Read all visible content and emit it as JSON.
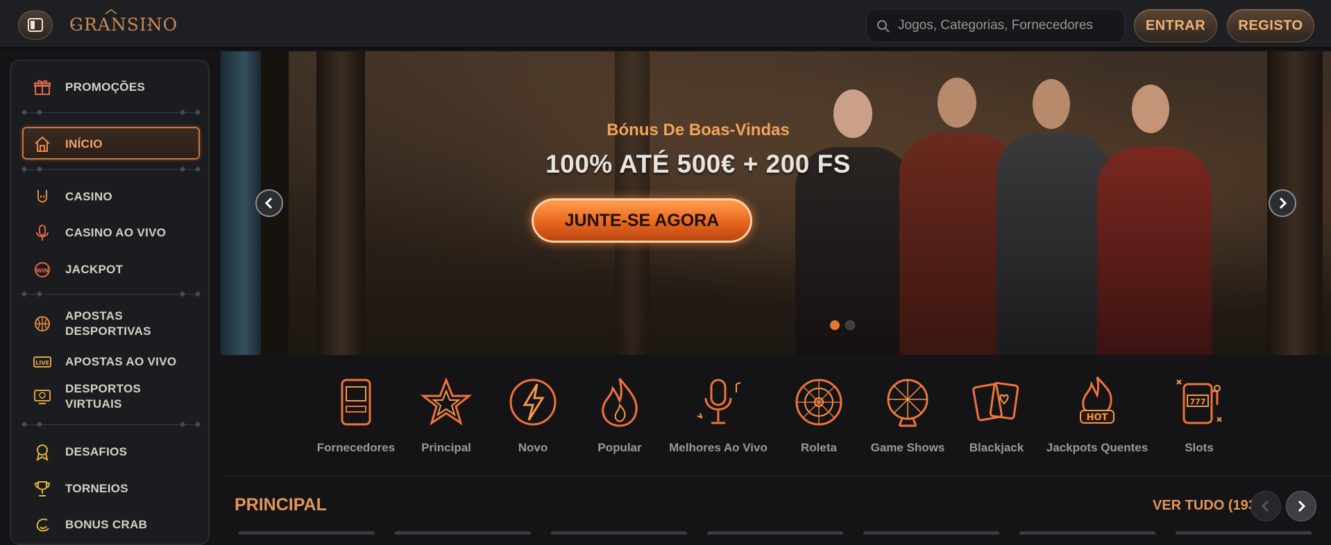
{
  "header": {
    "logo_text": "GRANSINO",
    "search_placeholder": "Jogos, Categorias, Fornecedores",
    "login_label": "ENTRAR",
    "register_label": "REGISTO"
  },
  "sidebar": {
    "items": [
      {
        "label": "PROMOÇÕES",
        "icon": "gift-icon"
      },
      {
        "label": "INÍCIO",
        "icon": "home-icon",
        "active": true
      },
      {
        "label": "CASINO",
        "icon": "rock-hand-icon"
      },
      {
        "label": "CASINO AO VIVO",
        "icon": "microphone-icon"
      },
      {
        "label": "JACKPOT",
        "icon": "jackpot-win-icon"
      },
      {
        "label": "APOSTAS DESPORTIVAS",
        "icon": "basketball-icon"
      },
      {
        "label": "APOSTAS AO VIVO",
        "icon": "live-badge-icon"
      },
      {
        "label": "DESPORTOS VIRTUAIS",
        "icon": "virtual-screen-icon"
      },
      {
        "label": "DESAFIOS",
        "icon": "medal-icon"
      },
      {
        "label": "TORNEIOS",
        "icon": "trophy-icon"
      },
      {
        "label": "BONUS CRAB",
        "icon": "crab-icon"
      }
    ]
  },
  "banner": {
    "title": "Bónus De Boas-Vindas",
    "offer": "100% ATÉ 500€ + 200 FS",
    "cta_label": "JUNTE-SE AGORA",
    "slide_count": 2,
    "active_slide": 1
  },
  "categories": [
    {
      "label": "Fornecedores",
      "icon": "slot-machine-cabinet-icon"
    },
    {
      "label": "Principal",
      "icon": "star-icon"
    },
    {
      "label": "Novo",
      "icon": "lightning-icon"
    },
    {
      "label": "Popular",
      "icon": "flame-icon"
    },
    {
      "label": "Melhores Ao Vivo",
      "icon": "live-microphone-icon"
    },
    {
      "label": "Roleta",
      "icon": "roulette-icon"
    },
    {
      "label": "Game Shows",
      "icon": "prize-wheel-icon"
    },
    {
      "label": "Blackjack",
      "icon": "cards-icon"
    },
    {
      "label": "Jackpots Quentes",
      "icon": "hot-jackpot-icon"
    },
    {
      "label": "Slots",
      "icon": "slot-777-icon"
    }
  ],
  "section": {
    "title": "PRINCIPAL",
    "see_all_label": "VER TUDO (193)"
  },
  "colors": {
    "accent": "#e5782f",
    "accent_text": "#e39657",
    "background": "#141416"
  }
}
